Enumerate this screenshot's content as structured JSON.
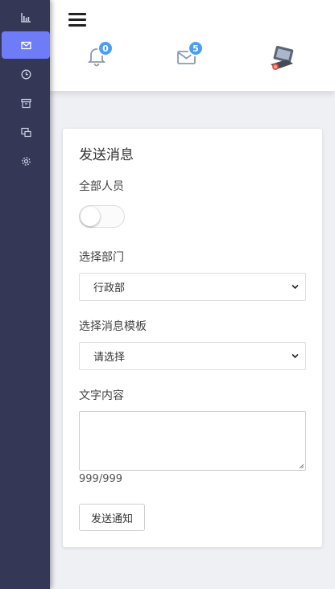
{
  "sidebar": {
    "items": [
      {
        "icon": "chart-icon",
        "active": false
      },
      {
        "icon": "mail-icon",
        "active": true
      },
      {
        "icon": "clock-icon",
        "active": false
      },
      {
        "icon": "archive-icon",
        "active": false
      },
      {
        "icon": "windows-icon",
        "active": false
      },
      {
        "icon": "gear-icon",
        "active": false
      }
    ]
  },
  "header": {
    "notifications": {
      "icon": "bell-icon",
      "count": "0"
    },
    "messages": {
      "icon": "envelope-icon",
      "count": "5"
    },
    "avatar_icon": "user-avatar"
  },
  "form": {
    "title": "发送消息",
    "all_staff_label": "全部人员",
    "all_staff_on": false,
    "department_label": "选择部门",
    "department_value": "行政部",
    "template_label": "选择消息模板",
    "template_value": "请选择",
    "text_label": "文字内容",
    "text_value": "",
    "counter": "999/999",
    "send_label": "发送通知"
  },
  "colors": {
    "sidebar_bg": "#343756",
    "active_item": "#6f7cf7",
    "badge": "#4a9ff5"
  }
}
